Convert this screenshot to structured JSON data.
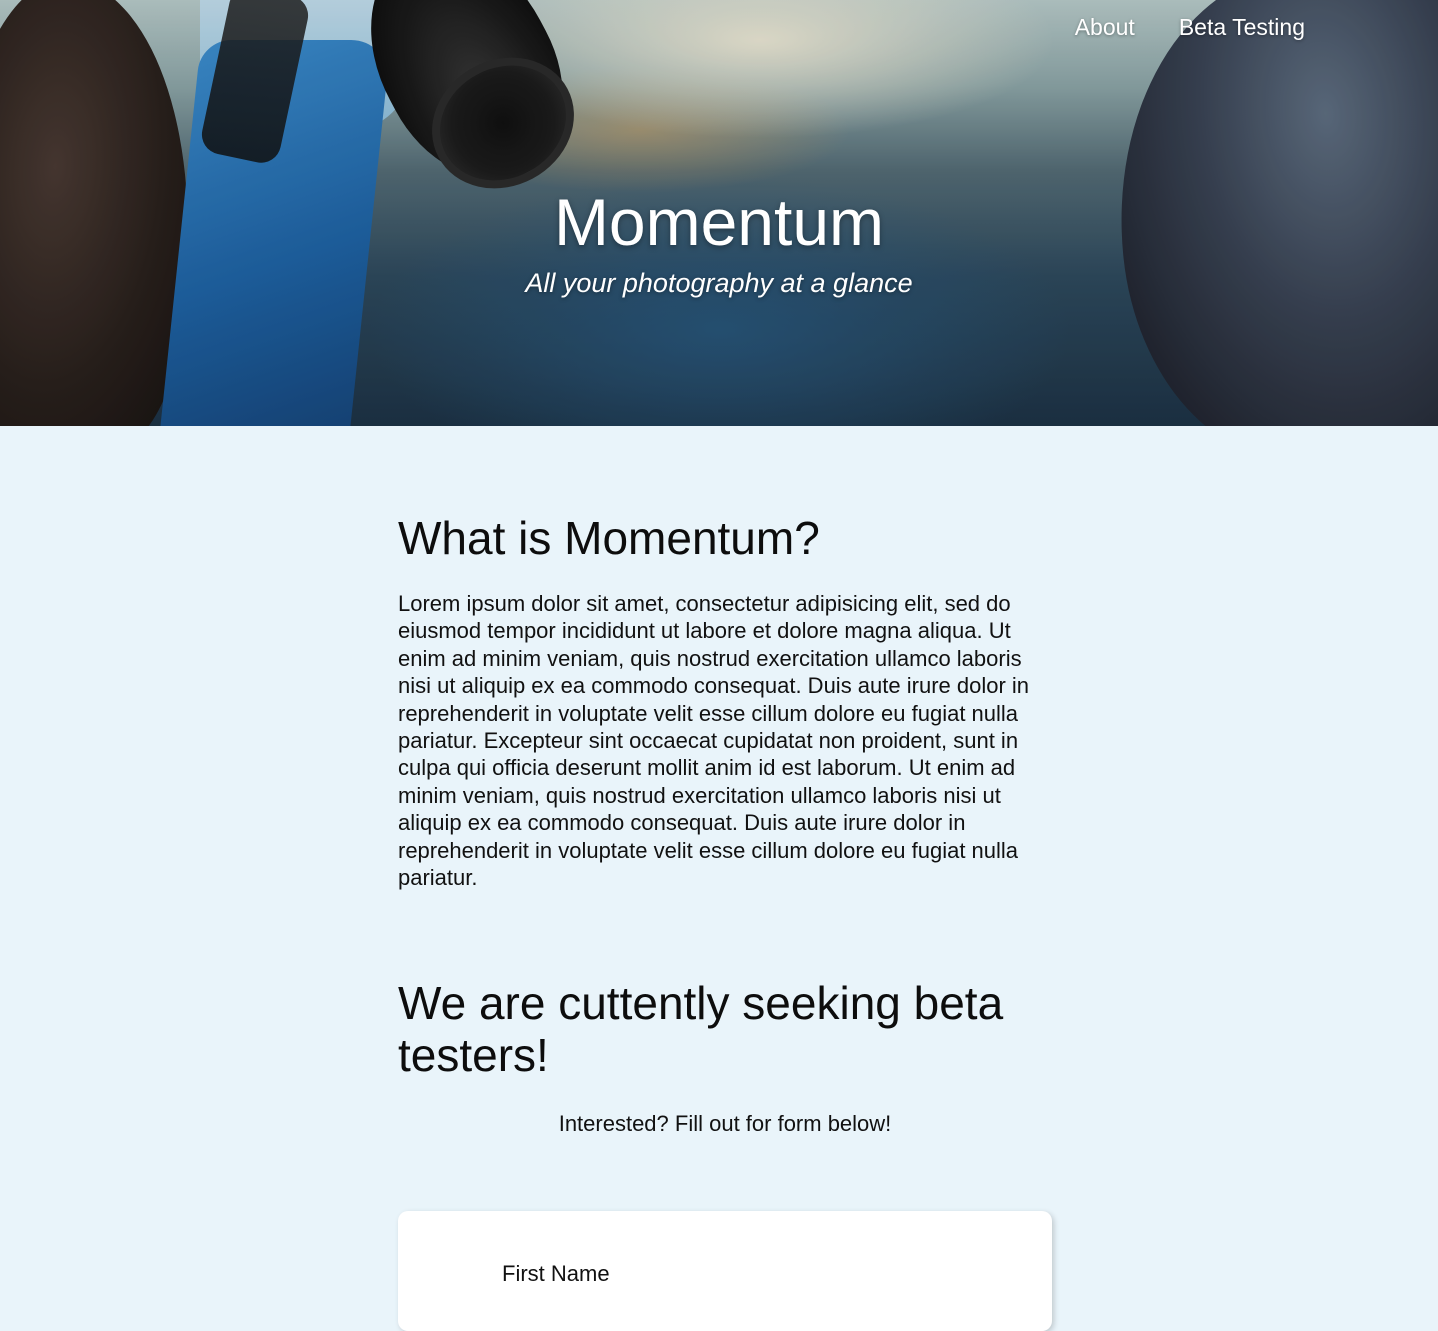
{
  "nav": {
    "items": [
      {
        "label": "About"
      },
      {
        "label": "Beta Testing"
      }
    ]
  },
  "hero": {
    "title": "Momentum",
    "subtitle": "All your photography at a glance"
  },
  "about": {
    "heading": "What is Momentum?",
    "body": "Lorem ipsum dolor sit amet, consectetur adipisicing elit, sed do eiusmod tempor incididunt ut labore et dolore magna aliqua. Ut enim ad minim veniam, quis nostrud exercitation ullamco laboris nisi ut aliquip ex ea commodo consequat. Duis aute irure dolor in reprehenderit in voluptate velit esse cillum dolore eu fugiat nulla pariatur. Excepteur sint occaecat cupidatat non proident, sunt in culpa qui officia deserunt mollit anim id est laborum. Ut enim ad minim veniam, quis nostrud exercitation ullamco laboris nisi ut aliquip ex ea commodo consequat. Duis aute irure dolor in reprehenderit in voluptate velit esse cillum dolore eu fugiat nulla pariatur."
  },
  "beta": {
    "heading": "We are cuttently seeking beta testers!",
    "cta": "Interested? Fill out for form below!"
  },
  "form": {
    "first_name_label": "First Name"
  },
  "colors": {
    "page_background": "#e9f4fa",
    "form_background": "#ffffff",
    "nav_text": "#ffffff"
  }
}
